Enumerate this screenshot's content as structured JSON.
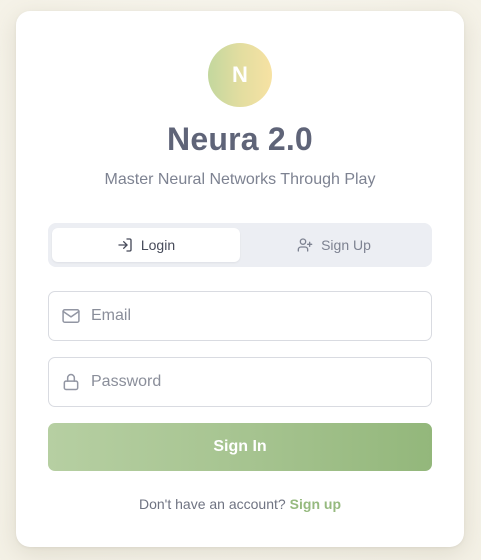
{
  "app": {
    "logo_letter": "N",
    "title": "Neura 2.0",
    "subtitle": "Master Neural Networks Through Play"
  },
  "tabs": {
    "active": "login",
    "items": [
      {
        "label": "Login",
        "icon": "login-icon"
      },
      {
        "label": "Sign Up",
        "icon": "user-plus-icon"
      }
    ]
  },
  "form": {
    "email": {
      "placeholder": "Email",
      "value": "",
      "icon": "mail-icon"
    },
    "password": {
      "placeholder": "Password",
      "value": "",
      "icon": "lock-icon"
    },
    "submit_label": "Sign In"
  },
  "footer": {
    "prompt": "Don't have an account?",
    "link_label": "Sign up"
  },
  "colors": {
    "accent": "#96ba7f",
    "button_gradient_start": "#b6cfa2",
    "button_gradient_end": "#93b77b",
    "logo_gradient_start": "#c3d79e",
    "logo_gradient_end": "#f7e2a3",
    "title": "#5f6478"
  }
}
